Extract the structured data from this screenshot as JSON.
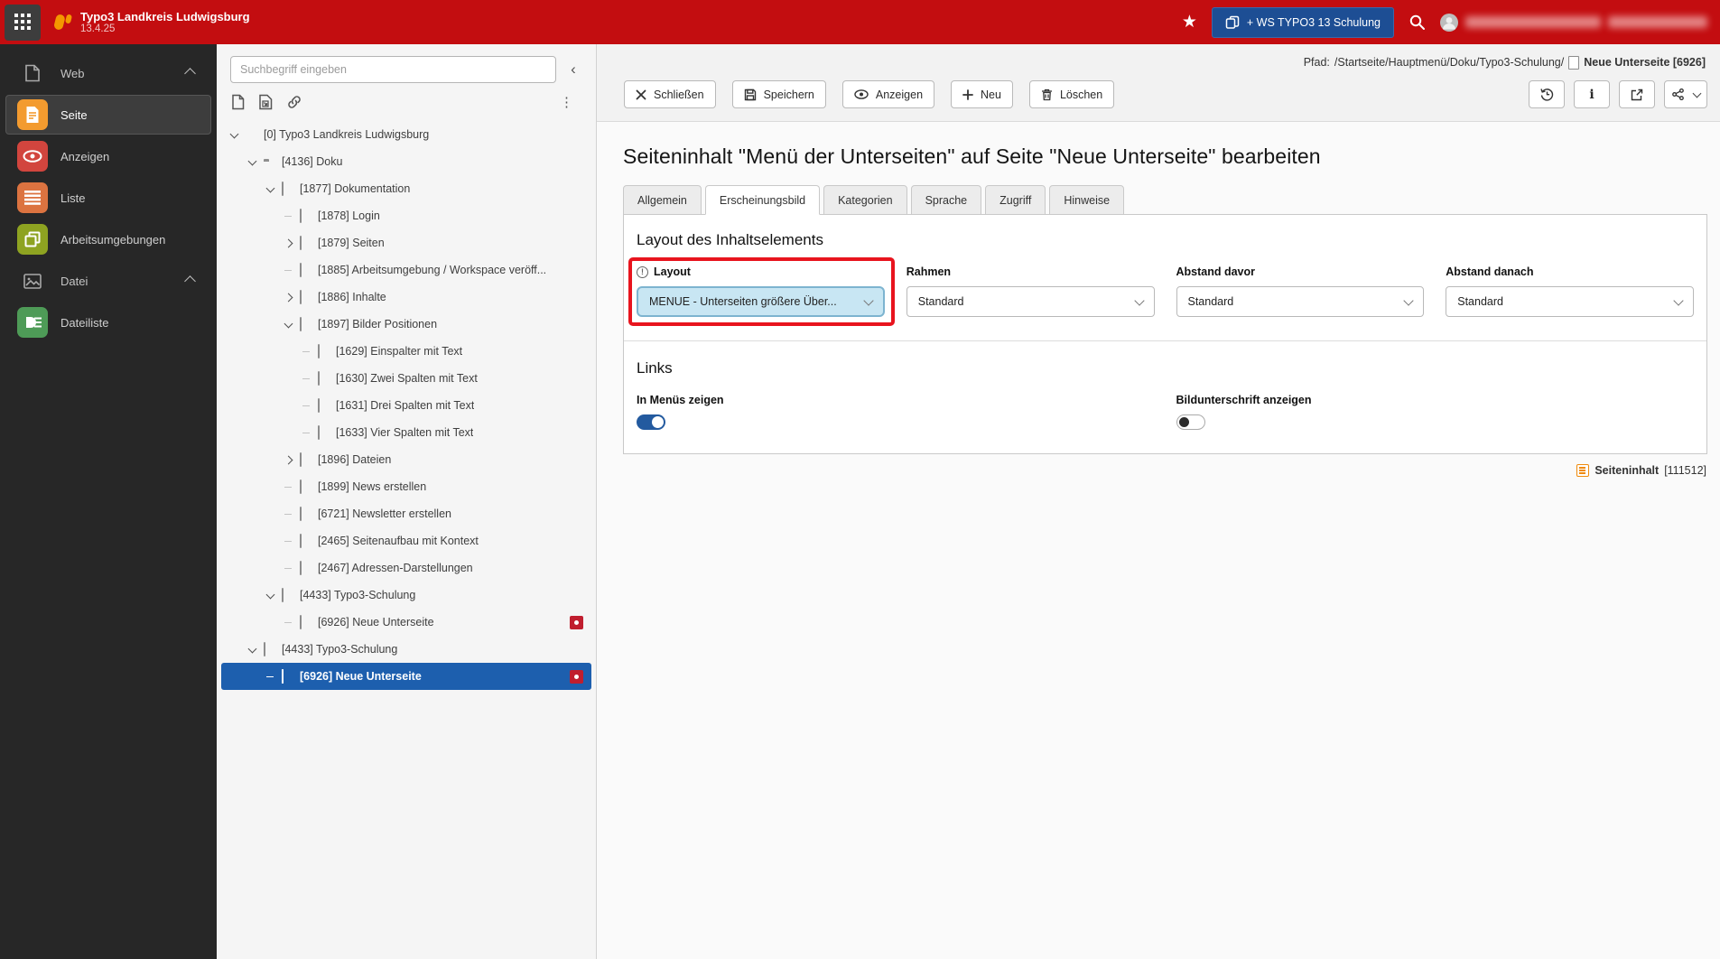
{
  "topbar": {
    "title": "Typo3 Landkreis Ludwigsburg",
    "version": "13.4.25",
    "workspace_button": "+ WS TYPO3 13 Schulung"
  },
  "icons": {
    "star": "★",
    "collapse": "‹",
    "kebab": "⋮",
    "info_button": "i",
    "field_info": "!"
  },
  "sidebar": {
    "groups": [
      {
        "label": "Web",
        "items": [
          {
            "label": "Seite",
            "active": true
          },
          {
            "label": "Anzeigen"
          },
          {
            "label": "Liste"
          },
          {
            "label": "Arbeitsumgebungen"
          }
        ]
      },
      {
        "label": "Datei",
        "items": [
          {
            "label": "Dateiliste"
          }
        ]
      }
    ]
  },
  "tree": {
    "search_placeholder": "Suchbegriff eingeben",
    "items": [
      {
        "label": "[0] Typo3 Landkreis Ludwigsburg",
        "level": 0,
        "expander": "down",
        "icon": "typo3"
      },
      {
        "label": "[4136] Doku",
        "level": 1,
        "expander": "down",
        "icon": "folder"
      },
      {
        "label": "[1877] Dokumentation",
        "level": 2,
        "expander": "down",
        "icon": "page"
      },
      {
        "label": "[1878] Login",
        "level": 3,
        "expander": "line",
        "icon": "page"
      },
      {
        "label": "[1879] Seiten",
        "level": 3,
        "expander": "right",
        "icon": "page"
      },
      {
        "label": "[1885] Arbeitsumgebung / Workspace veröff...",
        "level": 3,
        "expander": "line",
        "icon": "page"
      },
      {
        "label": "[1886] Inhalte",
        "level": 3,
        "expander": "right",
        "icon": "page"
      },
      {
        "label": "[1897] Bilder Positionen",
        "level": 3,
        "expander": "down",
        "icon": "page"
      },
      {
        "label": "[1629] Einspalter mit Text",
        "level": 4,
        "expander": "line",
        "icon": "page"
      },
      {
        "label": "[1630] Zwei Spalten mit Text",
        "level": 4,
        "expander": "line",
        "icon": "page"
      },
      {
        "label": "[1631] Drei Spalten mit Text",
        "level": 4,
        "expander": "line",
        "icon": "page"
      },
      {
        "label": "[1633] Vier Spalten mit Text",
        "level": 4,
        "expander": "line",
        "icon": "page"
      },
      {
        "label": "[1896] Dateien",
        "level": 3,
        "expander": "right",
        "icon": "page"
      },
      {
        "label": "[1899] News erstellen",
        "level": 3,
        "expander": "line",
        "icon": "page"
      },
      {
        "label": "[6721] Newsletter erstellen",
        "level": 3,
        "expander": "line",
        "icon": "page"
      },
      {
        "label": "[2465] Seitenaufbau mit Kontext",
        "level": 3,
        "expander": "line",
        "icon": "page"
      },
      {
        "label": "[2467] Adressen-Darstellungen",
        "level": 3,
        "expander": "line",
        "icon": "page"
      },
      {
        "label": "[4433] Typo3-Schulung",
        "level": 2,
        "expander": "down",
        "icon": "page"
      },
      {
        "label": "[6926] Neue Unterseite",
        "level": 3,
        "expander": "line",
        "icon": "page",
        "badge": true
      },
      {
        "label": "[4433] Typo3-Schulung",
        "level": 1,
        "expander": "down",
        "icon": "page"
      },
      {
        "label": "[6926] Neue Unterseite",
        "level": 2,
        "expander": "line",
        "icon": "page",
        "badge": true,
        "selected": true
      }
    ]
  },
  "docheader": {
    "path_label": "Pfad:",
    "path": "/Startseite/Hauptmenü/Doku/Typo3-Schulung/",
    "current_page": "Neue Unterseite [6926]",
    "buttons": [
      {
        "label": "Schließen"
      },
      {
        "label": "Speichern"
      },
      {
        "label": "Anzeigen"
      },
      {
        "label": "Neu"
      },
      {
        "label": "Löschen"
      }
    ]
  },
  "content": {
    "title": "Seiteninhalt \"Menü der Unterseiten\" auf Seite \"Neue Unterseite\" bearbeiten",
    "tabs": [
      "Allgemein",
      "Erscheinungsbild",
      "Kategorien",
      "Sprache",
      "Zugriff",
      "Hinweise"
    ],
    "active_tab": "Erscheinungsbild",
    "appearance": {
      "heading": "Layout des Inhaltselements",
      "fields": [
        {
          "label": "Layout",
          "value": "MENUE - Unterseiten größere Über...",
          "highlighted": true
        },
        {
          "label": "Rahmen",
          "value": "Standard"
        },
        {
          "label": "Abstand davor",
          "value": "Standard"
        },
        {
          "label": "Abstand danach",
          "value": "Standard"
        }
      ]
    },
    "links": {
      "heading": "Links",
      "toggles": [
        {
          "label": "In Menüs zeigen",
          "state": "on"
        },
        {
          "label": "Bildunterschrift anzeigen",
          "state": "off"
        }
      ]
    }
  },
  "footer": {
    "record_type": "Seiteninhalt",
    "record_id": "[111512]"
  }
}
